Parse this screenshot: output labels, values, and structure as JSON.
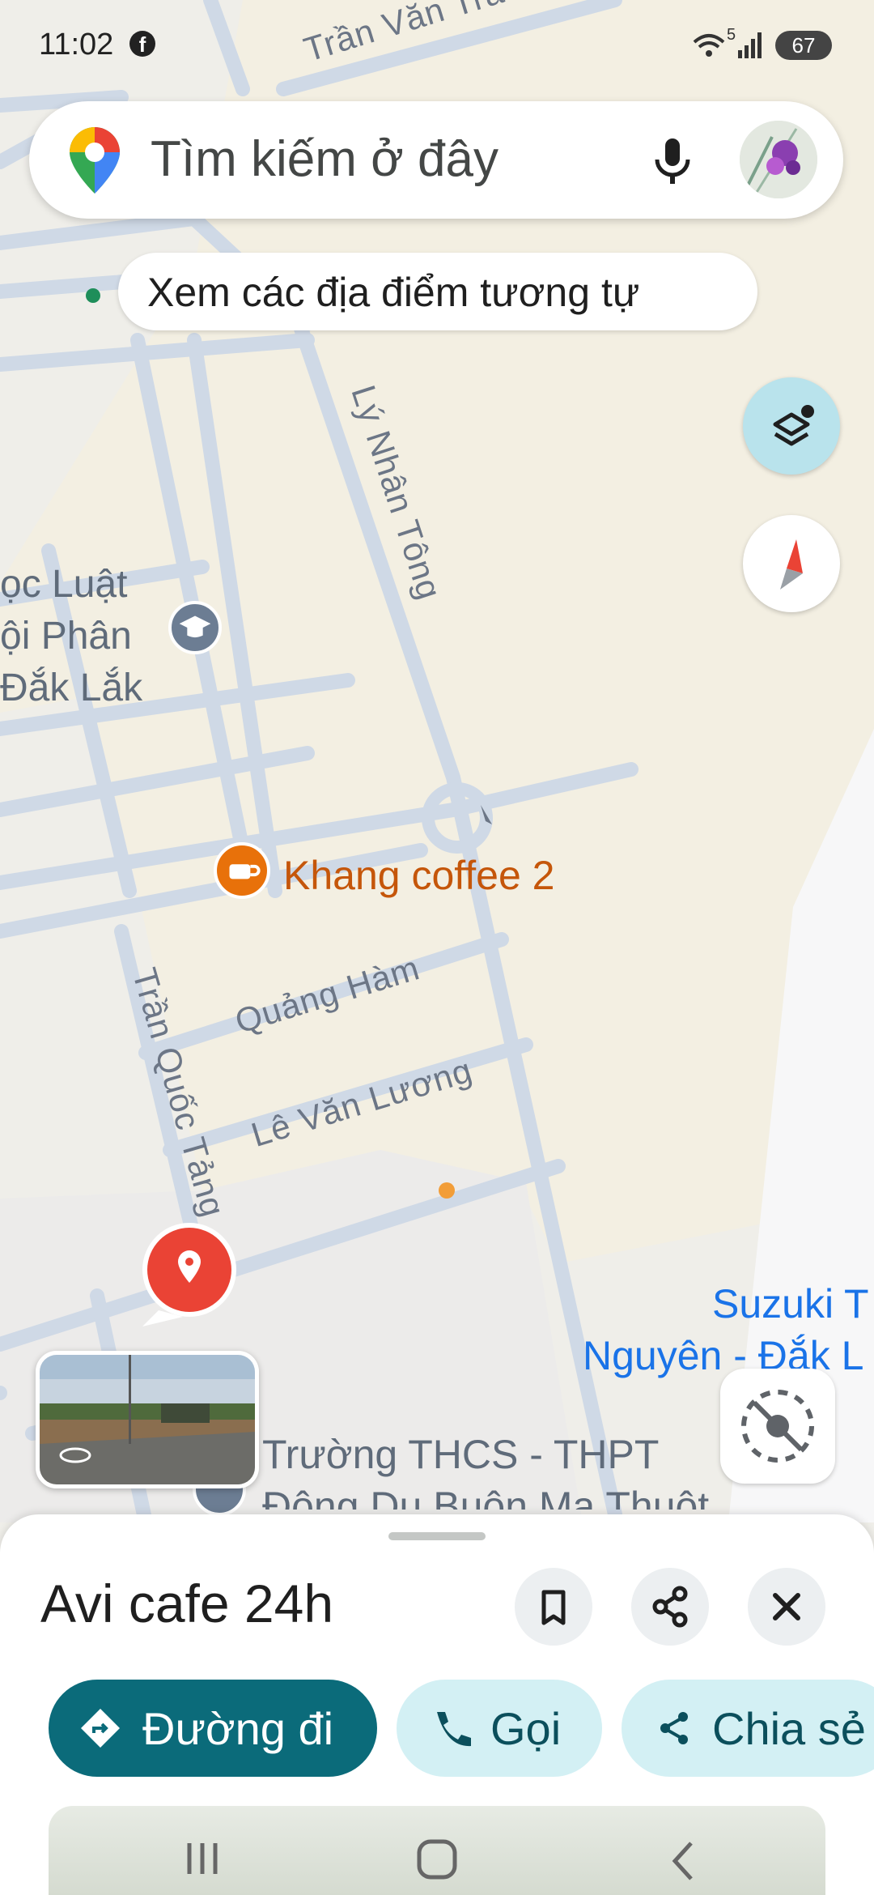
{
  "status_bar": {
    "time": "11:02",
    "battery": "67",
    "network": "5"
  },
  "search": {
    "placeholder": "Tìm kiếm ở đây"
  },
  "suggestion_chip": {
    "label": "Xem các địa điểm tương tự"
  },
  "map": {
    "roads": [
      "Trần Văn Trà",
      "Lý Nhân Tông",
      "Quảng Hàm",
      "Lê Văn Lương",
      "Trần Quốc Tảng"
    ],
    "places": {
      "school_partial": [
        "ọc Luật",
        "ội Phân",
        "Đắk Lắk"
      ],
      "cafe": "Khang coffee 2",
      "suzuki": [
        "Suzuki T",
        "Nguyên - Đắk L"
      ],
      "school2": [
        "Trường THCS - THPT",
        "Đông Du Buôn Ma Thuột"
      ]
    },
    "colors": {
      "cafe": "#e8710a",
      "pin": "#ea4335",
      "poi_blue": "#1a73e8"
    }
  },
  "place_sheet": {
    "title": "Avi cafe 24h",
    "actions": {
      "directions": "Đường đi",
      "call": "Gọi",
      "share": "Chia sẻ"
    },
    "colors": {
      "primary": "#0b6b7a",
      "secondary": "#d3f0f4"
    }
  },
  "icons": [
    "maps-pin-icon",
    "mic-icon",
    "layers-icon",
    "compass-icon",
    "locate-off-icon",
    "bookmark-icon",
    "share-icon",
    "close-icon",
    "directions-icon",
    "phone-icon"
  ]
}
